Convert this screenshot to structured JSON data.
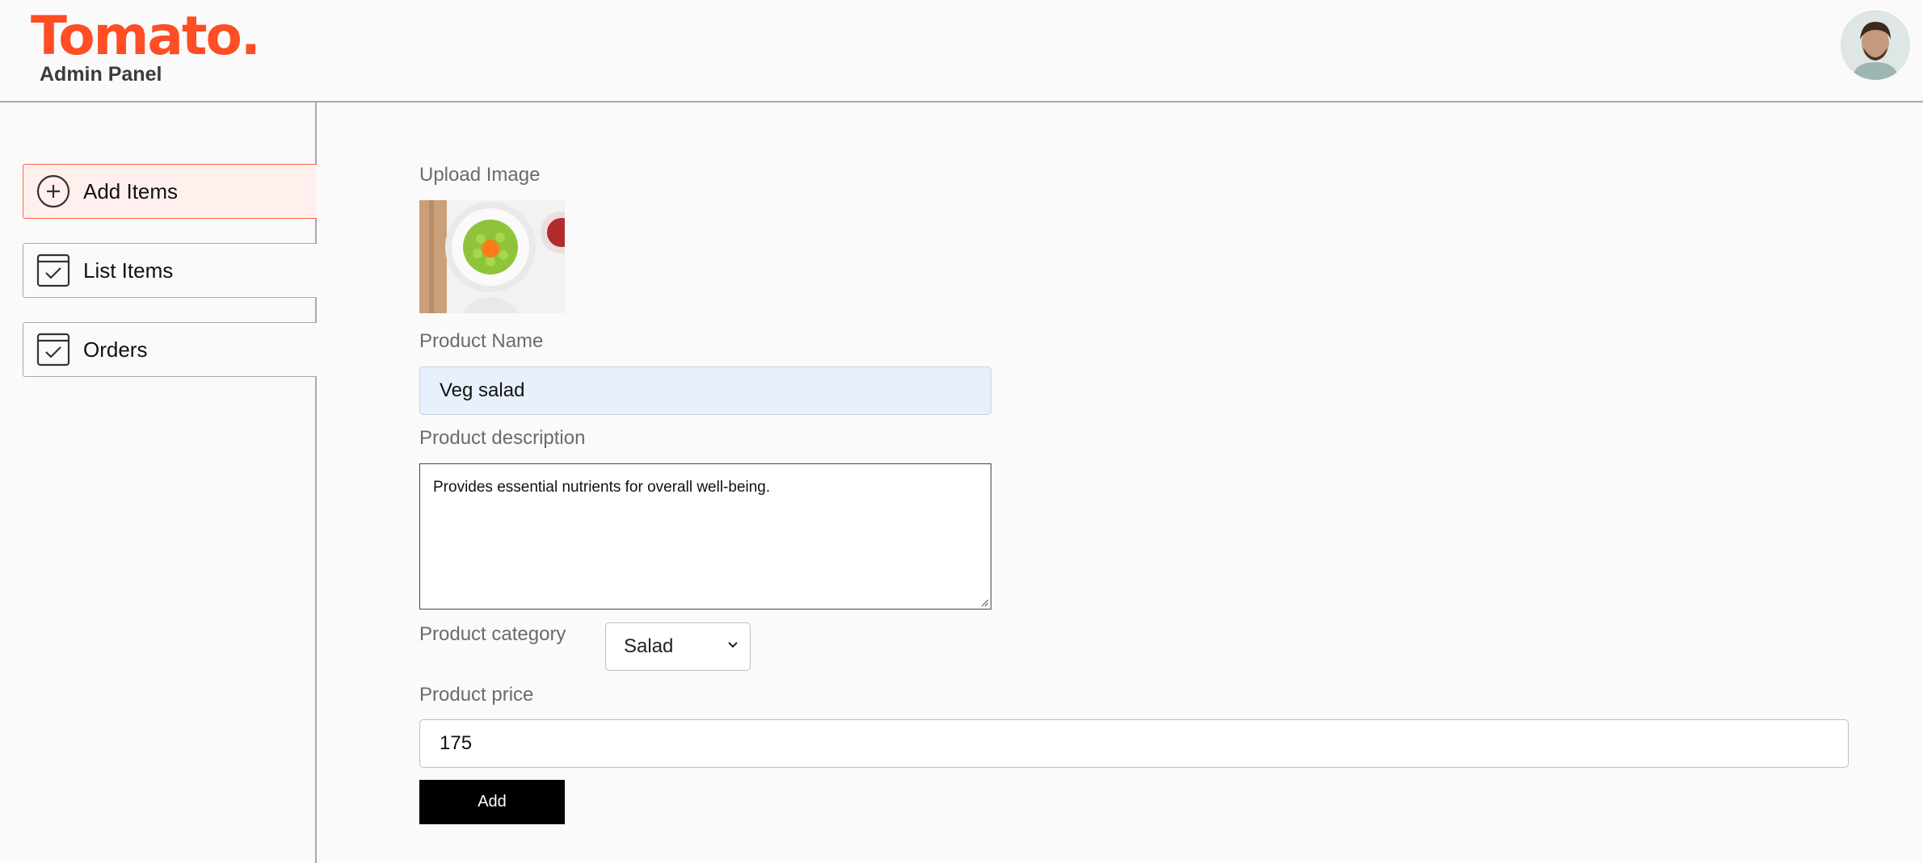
{
  "brand": {
    "logo": "Tomato.",
    "subtitle": "Admin Panel",
    "color": "#ff4d24"
  },
  "sidebar": {
    "items": [
      {
        "label": "Add Items",
        "icon": "add-circle-icon",
        "active": true
      },
      {
        "label": "List Items",
        "icon": "checklist-icon",
        "active": false
      },
      {
        "label": "Orders",
        "icon": "checklist-icon",
        "active": false
      }
    ]
  },
  "form": {
    "upload_label": "Upload Image",
    "name_label": "Product Name",
    "name_value": "Veg salad",
    "description_label": "Product description",
    "description_value": "Provides essential nutrients for overall well-being.",
    "category_label": "Product category",
    "category_value": "Salad",
    "price_label": "Product price",
    "price_value": "175",
    "submit_label": "Add"
  },
  "colors": {
    "accent": "#ff4d24",
    "active_bg": "#fff0ed",
    "active_border": "#ff6448",
    "button": "#000000"
  }
}
